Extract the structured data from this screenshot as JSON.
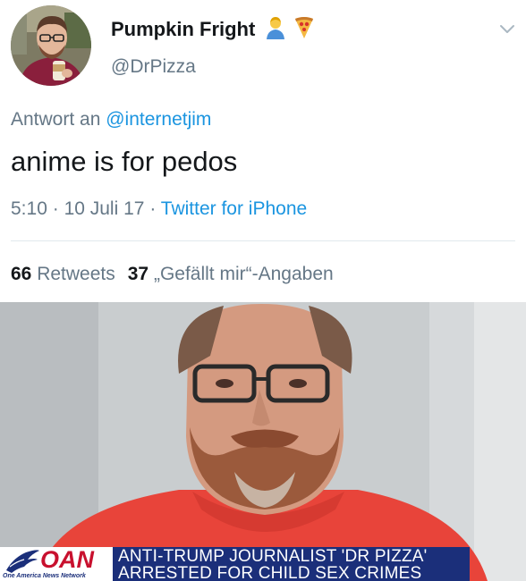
{
  "tweet": {
    "display_name": "Pumpkin Fright",
    "name_emojis": [
      "man-icon",
      "pizza-icon"
    ],
    "handle": "@DrPizza",
    "reply_prefix": "Antwort an",
    "reply_mention": "@internetjim",
    "text": "anime is for pedos",
    "time": "5:10",
    "date": "10 Juli 17",
    "separator": "·",
    "source": "Twitter for iPhone",
    "retweets_count": "66",
    "retweets_label": "Retweets",
    "likes_count": "37",
    "likes_label": "„Gefällt mir“-Angaben",
    "colors": {
      "text": "#14171a",
      "secondary": "#657786",
      "link": "#1b95e0",
      "divider": "#e1e8ed"
    }
  },
  "news_photo": {
    "network_logo": "OAN",
    "network_name": "One America News Network",
    "headline_line1": "ANTI-TRUMP JOURNALIST 'DR PIZZA'",
    "headline_line2": "ARRESTED FOR CHILD SEX CRIMES",
    "colors": {
      "chyron": "#1b2f7a",
      "logo_red": "#c8102e"
    }
  }
}
